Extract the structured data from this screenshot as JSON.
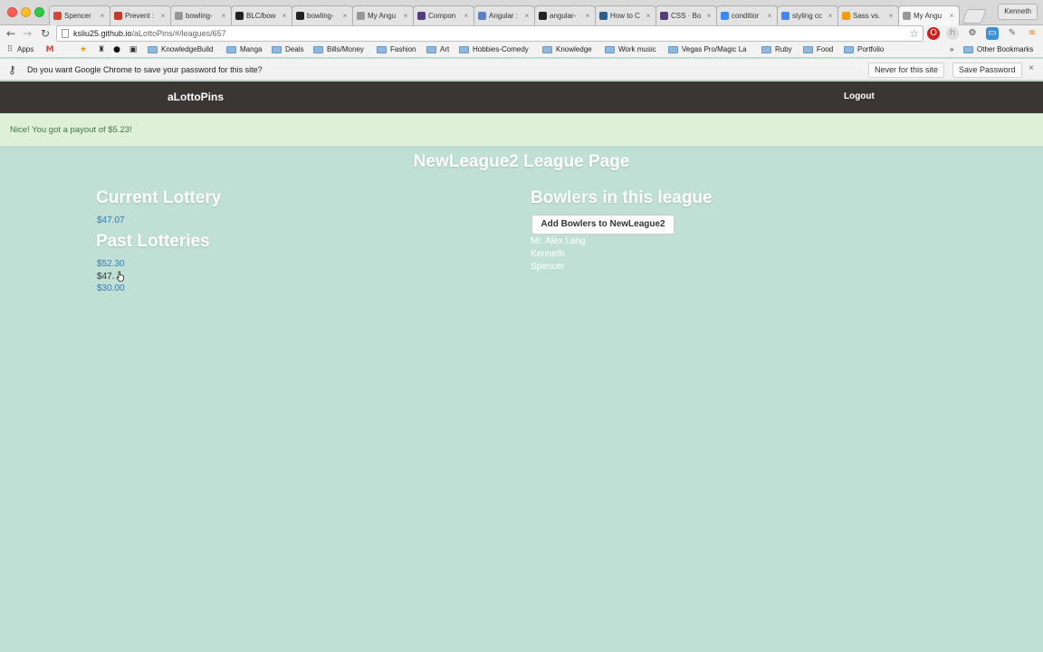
{
  "browser": {
    "tabs": [
      {
        "title": "Spencer",
        "icon": "gmail-icon",
        "color": "#d44638"
      },
      {
        "title": "Prevent :",
        "icon": "site-icon",
        "color": "#c0392b"
      },
      {
        "title": "bowling-",
        "icon": "page-icon",
        "color": "#999999"
      },
      {
        "title": "BLC/bow",
        "icon": "github-icon",
        "color": "#222222"
      },
      {
        "title": "bowling-",
        "icon": "github-icon",
        "color": "#222222"
      },
      {
        "title": "My Angu",
        "icon": "page-icon",
        "color": "#999999"
      },
      {
        "title": "Compon",
        "icon": "bootstrap-icon",
        "color": "#563d7c"
      },
      {
        "title": "Angular :",
        "icon": "angular-icon",
        "color": "#5b7fbf"
      },
      {
        "title": "angular-",
        "icon": "github-icon",
        "color": "#222222"
      },
      {
        "title": "How to C",
        "icon": "site-icon",
        "color": "#2a5f8a"
      },
      {
        "title": "CSS · Bo",
        "icon": "bootstrap-icon",
        "color": "#563d7c"
      },
      {
        "title": "conditior",
        "icon": "google-icon",
        "color": "#4285f4"
      },
      {
        "title": "styling cc",
        "icon": "google-icon",
        "color": "#4285f4"
      },
      {
        "title": "Sass vs.",
        "icon": "site-icon",
        "color": "#f39c12"
      },
      {
        "title": "My Angu",
        "icon": "page-icon",
        "color": "#999999",
        "active": true
      }
    ],
    "profile": "Kenneth",
    "url_host": "ksliu25.github.io",
    "url_path": "/aLottoPins/#/leagues/657",
    "bookmarks": {
      "apps": "Apps",
      "folders": [
        "KnowledgeBuild",
        "Manga",
        "Deals",
        "Bills/Money",
        "Fashion",
        "Art",
        "Hobbies-Comedy",
        "Knowledge",
        "Work music",
        "Vegas Pro/Magic La",
        "Ruby",
        "Food",
        "Portfolio"
      ],
      "more": "»",
      "other": "Other Bookmarks"
    },
    "infobar": {
      "message": "Do you want Google Chrome to save your password for this site?",
      "never": "Never for this site",
      "save": "Save Password",
      "close": "×"
    }
  },
  "app": {
    "brand": "aLottoPins",
    "logout": "Logout",
    "flash": "Nice! You got a payout of $5.23!",
    "page_title": "NewLeague2 League Page",
    "current_lottery": {
      "heading": "Current Lottery",
      "amount": "$47.07"
    },
    "past_lotteries": {
      "heading": "Past Lotteries",
      "amounts": [
        "$52.30",
        "$47.",
        "$30.00"
      ]
    },
    "bowlers": {
      "heading": "Bowlers in this league",
      "add_button": "Add Bowlers to NewLeague2",
      "names": [
        "Mr. Alex Lang",
        "Kenneth",
        "Spencer"
      ]
    }
  }
}
